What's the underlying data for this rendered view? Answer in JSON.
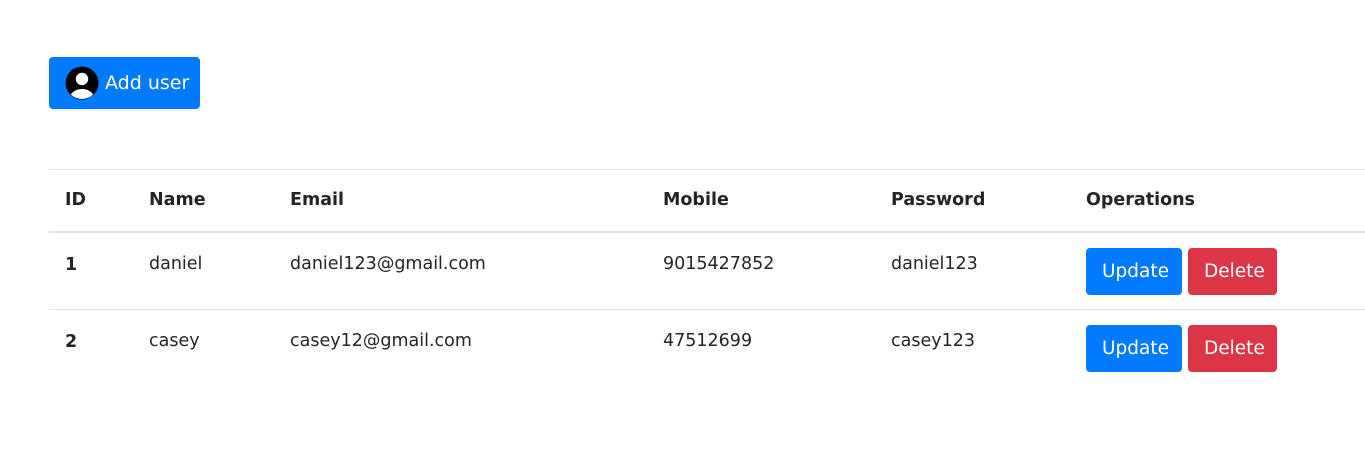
{
  "add_button": {
    "label": "Add user",
    "icon": "user-avatar-icon"
  },
  "colors": {
    "primary": "#007bff",
    "danger": "#dc3545",
    "border": "#dee2e6",
    "text": "#212529"
  },
  "table": {
    "columns": [
      "ID",
      "Name",
      "Email",
      "Mobile",
      "Password",
      "Operations"
    ],
    "rows": [
      {
        "id": "1",
        "name": "daniel",
        "email": "daniel123@gmail.com",
        "mobile": "9015427852",
        "password": "daniel123",
        "update_label": "Update",
        "delete_label": "Delete"
      },
      {
        "id": "2",
        "name": "casey",
        "email": "casey12@gmail.com",
        "mobile": "47512699",
        "password": "casey123",
        "update_label": "Update",
        "delete_label": "Delete"
      }
    ]
  }
}
